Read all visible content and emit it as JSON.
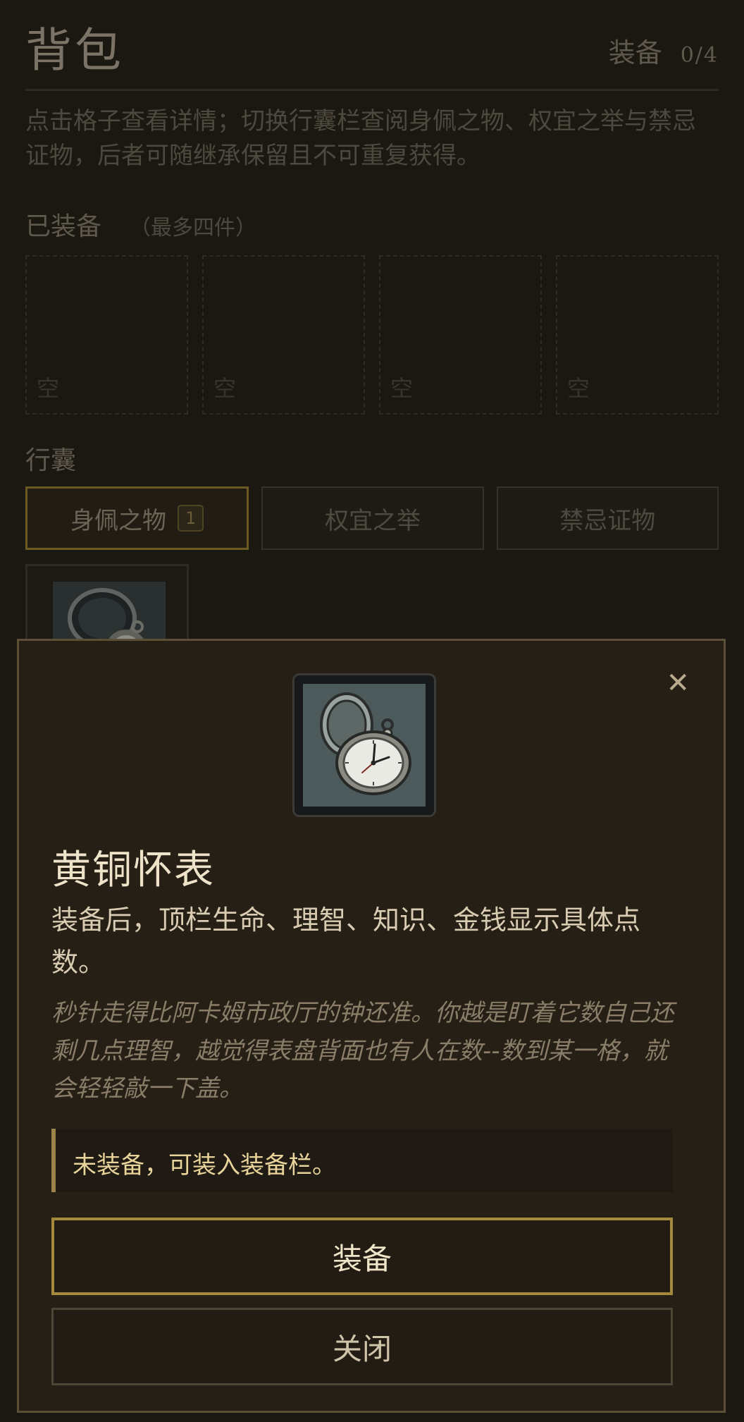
{
  "header": {
    "title": "背包",
    "equip_label": "装备",
    "equip_count": "0/4"
  },
  "description": "点击格子查看详情；切换行囊栏查阅身佩之物、权宜之举与禁忌证物，后者可随继承保留且不可重复获得。",
  "equipped": {
    "label": "已装备",
    "hint": "（最多四件）",
    "slots": [
      "空",
      "空",
      "空",
      "空"
    ]
  },
  "bag": {
    "label": "行囊",
    "tabs": [
      {
        "label": "身佩之物",
        "badge": "1",
        "active": true
      },
      {
        "label": "权宜之举"
      },
      {
        "label": "禁忌证物"
      }
    ],
    "items": [
      {
        "icon": "pocket-watch-icon"
      }
    ]
  },
  "modal": {
    "close_glyph": "✕",
    "item_icon": "pocket-watch-icon",
    "item_name": "黄铜怀表",
    "effect": "装备后，顶栏生命、理智、知识、金钱显示具体点数。",
    "flavor": "秒针走得比阿卡姆市政厅的钟还准。你越是盯着它数自己还剩几点理智，越觉得表盘背面也有人在数--数到某一格，就会轻轻敲一下盖。",
    "status": "未装备，可装入装备栏。",
    "equip_button": "装备",
    "close_button": "关闭"
  },
  "colors": {
    "background": "#1b1812",
    "modal_bg": "#251f16",
    "accent_gold": "#a58a3c",
    "status_text": "#e8d49a"
  }
}
